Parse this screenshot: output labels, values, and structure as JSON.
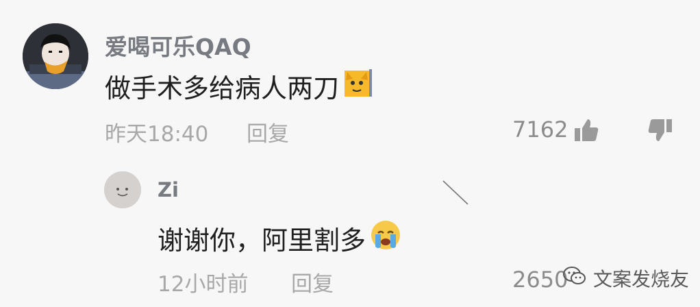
{
  "comment": {
    "username": "爱喝可乐QAQ",
    "text": "做手术多给病人两刀",
    "time": "昨天18:40",
    "reply_label": "回复",
    "likes": "7162",
    "emoji": "cat-face-emoji"
  },
  "reply": {
    "username": "Zi",
    "text": "谢谢你，阿里割多",
    "time": "12小时前",
    "reply_label": "回复",
    "likes": "2650",
    "emoji": "crying-face-emoji"
  },
  "watermark": {
    "text": "文案发烧友",
    "icon": "wechat-icon"
  },
  "colors": {
    "background": "#f7f7f7",
    "username": "#777a80",
    "text": "#1f1f1f",
    "meta": "#a8a8a8"
  }
}
